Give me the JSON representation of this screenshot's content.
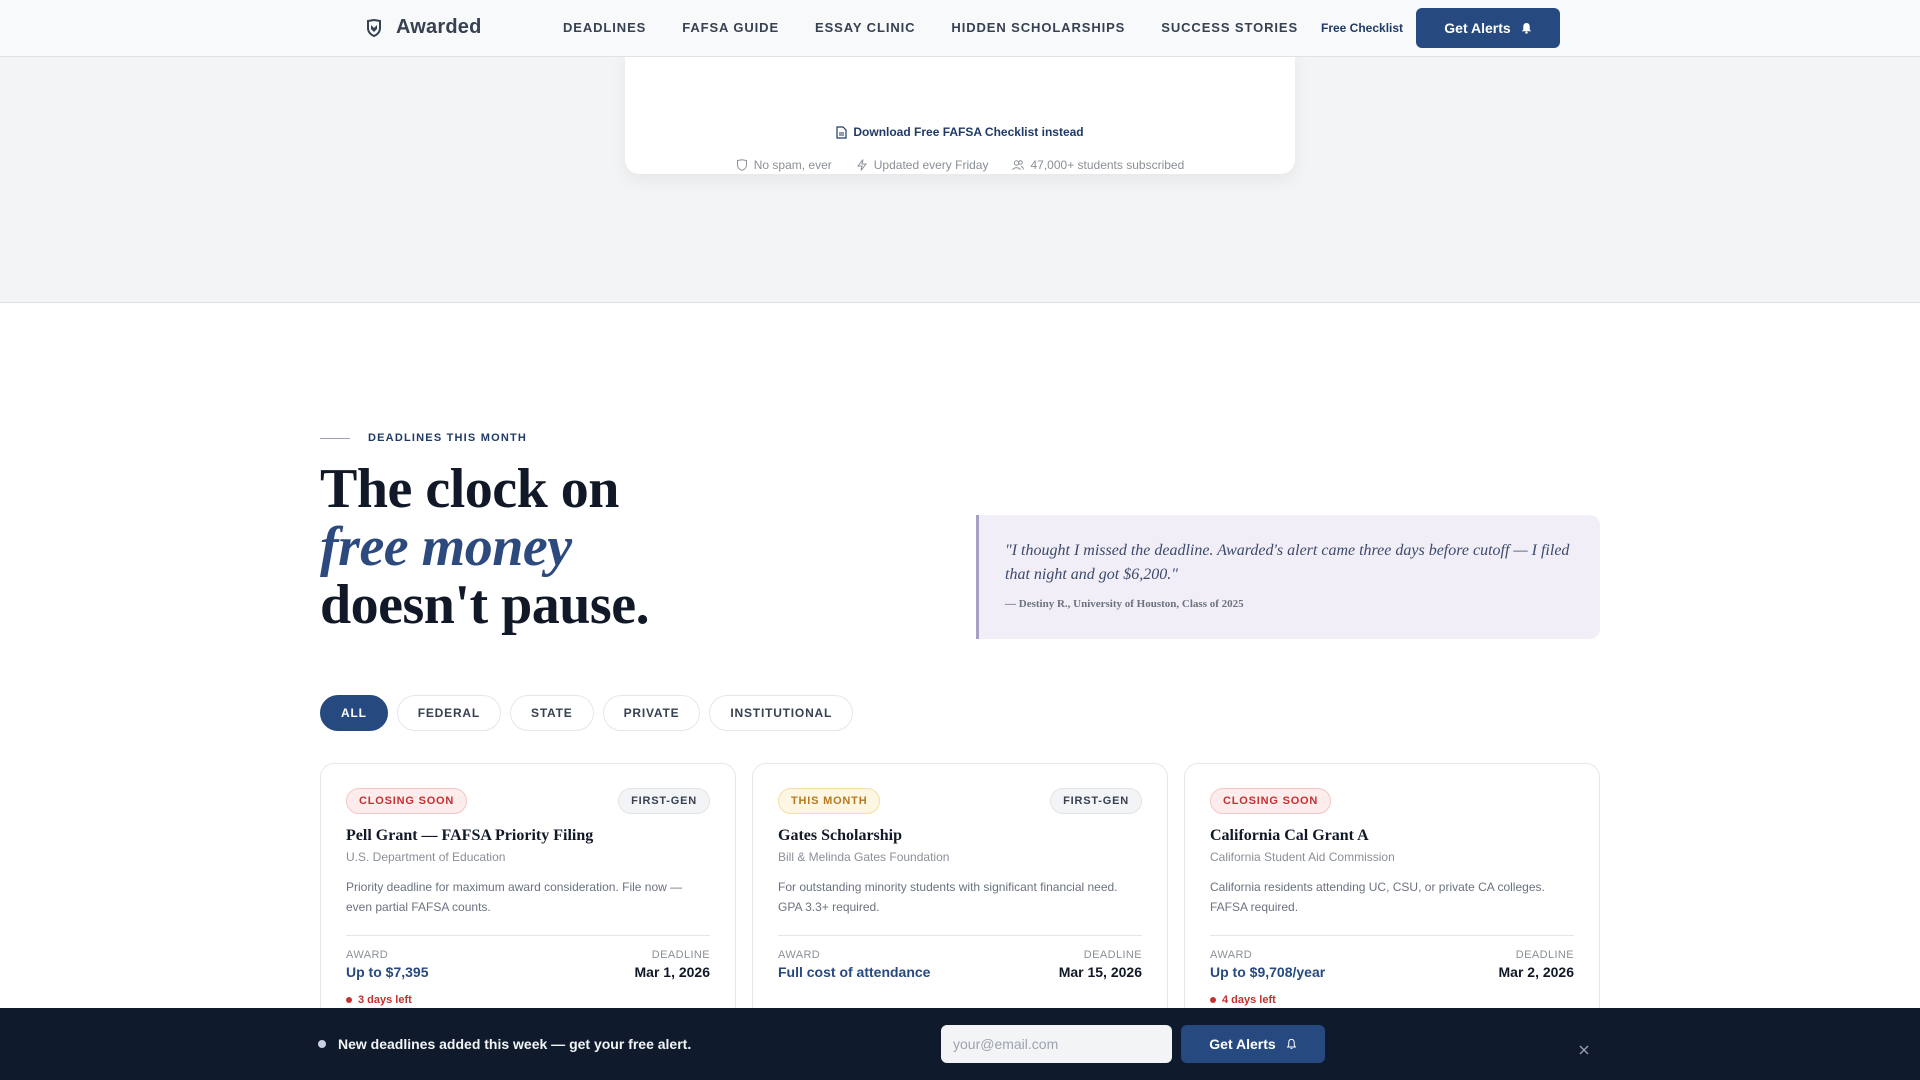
{
  "colors": {
    "brand": "#264a80",
    "accent_text": "#2c4a7e",
    "danger": "#c53030",
    "warning": "#b7791f",
    "bar_bg": "#0f1b2d"
  },
  "nav": {
    "brand": "Awarded",
    "links": [
      "DEADLINES",
      "FAFSA GUIDE",
      "ESSAY CLINIC",
      "HIDDEN SCHOLARSHIPS",
      "SUCCESS STORIES"
    ],
    "free_checklist": "Free Checklist",
    "cta": "Get Alerts",
    "icons": {
      "brand": "shield-check-icon",
      "cta": "bell-icon"
    }
  },
  "hero": {
    "download_link": "Download Free FAFSA Checklist instead",
    "trust": [
      {
        "icon": "shield-icon",
        "text": "No spam, ever"
      },
      {
        "icon": "lightning-icon",
        "text": "Updated every Friday"
      },
      {
        "icon": "users-icon",
        "text": "47,000+ students subscribed"
      }
    ]
  },
  "deadlines": {
    "eyebrow": "DEADLINES THIS MONTH",
    "headline_line1": "The clock on",
    "headline_accent": "free money",
    "headline_line3": "doesn't pause.",
    "quote": "\"I thought I missed the deadline. Awarded's alert came three days before cutoff — I filed that night and got $6,200.\"",
    "quote_author": "— Destiny R., University of Houston, Class of 2025",
    "filters": [
      "ALL",
      "FEDERAL",
      "STATE",
      "PRIVATE",
      "INSTITUTIONAL"
    ],
    "active_filter": "ALL",
    "award_label": "AWARD",
    "deadline_label": "DEADLINE",
    "cards": [
      {
        "status": "CLOSING SOON",
        "tag": "FIRST-GEN",
        "title": "Pell Grant — FAFSA Priority Filing",
        "org": "U.S. Department of Education",
        "desc": "Priority deadline for maximum award consideration. File now — even partial FAFSA counts.",
        "award": "Up to $7,395",
        "deadline": "Mar 1, 2026",
        "days_left": "3 days left"
      },
      {
        "status": "THIS MONTH",
        "tag": "FIRST-GEN",
        "title": "Gates Scholarship",
        "org": "Bill & Melinda Gates Foundation",
        "desc": "For outstanding minority students with significant financial need. GPA 3.3+ required.",
        "award": "Full cost of attendance",
        "deadline": "Mar 15, 2026",
        "days_left": ""
      },
      {
        "status": "CLOSING SOON",
        "tag": "",
        "title": "California Cal Grant A",
        "org": "California Student Aid Commission",
        "desc": "California residents attending UC, CSU, or private CA colleges. FAFSA required.",
        "award": "Up to $9,708/year",
        "deadline": "Mar 2, 2026",
        "days_left": "4 days left"
      }
    ]
  },
  "bottom_bar": {
    "message": "New deadlines added this week — get your free alert.",
    "email_placeholder": "your@email.com",
    "cta": "Get Alerts",
    "icons": {
      "cta": "bell-outline-icon",
      "close": "close-icon"
    }
  }
}
